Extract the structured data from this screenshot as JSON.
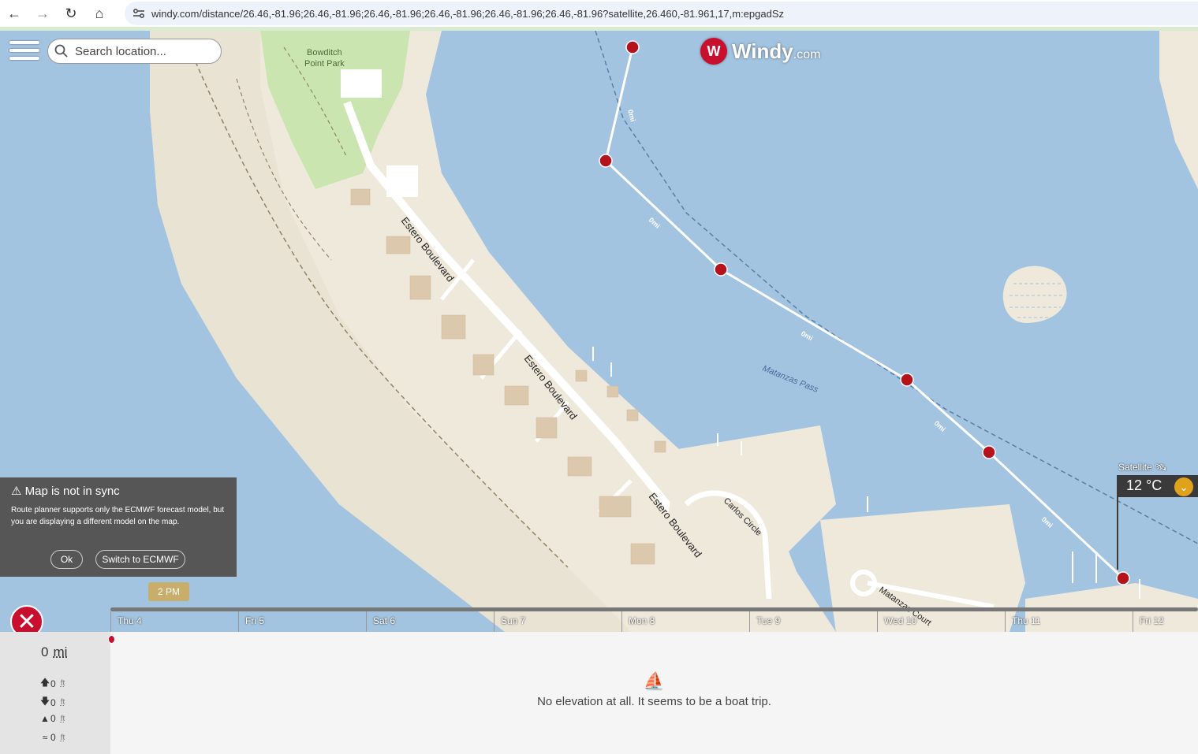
{
  "browser": {
    "url": "windy.com/distance/26.46,-81.96;26.46,-81.96;26.46,-81.96;26.46,-81.96;26.46,-81.96;26.46,-81.96?satellite,26.460,-81.961,17,m:epgadSz",
    "back_icon": "back-arrow-icon",
    "forward_icon": "forward-arrow-icon",
    "reload_icon": "reload-icon",
    "home_icon": "home-icon"
  },
  "search": {
    "placeholder": "Search location..."
  },
  "logo": {
    "name": "Windy",
    "suffix": ".com"
  },
  "map": {
    "park_label_1": "Bowditch",
    "park_label_2": "Point Park",
    "street_1": "Estero Boulevard",
    "street_2": "Estero Boulevard",
    "street_3": "Estero Boulevard",
    "carlos_circle": "Carlos Circle",
    "matanzas_court": "Matanzas Court",
    "water_label": "Matanzas Pass",
    "segment_labels": [
      "0mi",
      "0mi",
      "0mi",
      "0mi",
      "0mi"
    ]
  },
  "sync_panel": {
    "title": "Map is not in sync",
    "body": "Route planner supports only the ECMWF forecast model, but you are displaying a different model on the map.",
    "ok_label": "Ok",
    "switch_label": "Switch to ECMWF"
  },
  "layer": {
    "name": "Satellite",
    "temperature": "12 °C"
  },
  "timeline": {
    "current_time": "2 PM",
    "days": [
      "Thu 4",
      "Fri 5",
      "Sat 6",
      "Sun 7",
      "Mon 8",
      "Tue 9",
      "Wed 10",
      "Thu 11",
      "Fri 12"
    ]
  },
  "stats": {
    "distance_value": "0",
    "distance_unit": "mi",
    "ascent": "0",
    "ascent_unit": "ft",
    "descent": "0",
    "descent_unit": "ft",
    "max_elevation": "0",
    "max_unit": "ft",
    "average": "0",
    "average_unit": "ft"
  },
  "message": {
    "text": "No elevation at all. It seems to be a boat trip."
  },
  "colors": {
    "water": "#a3c4e1",
    "land": "#efe9dc",
    "park": "#cbe5b1",
    "route": "#ffffff",
    "waypoint": "#b5121b"
  }
}
